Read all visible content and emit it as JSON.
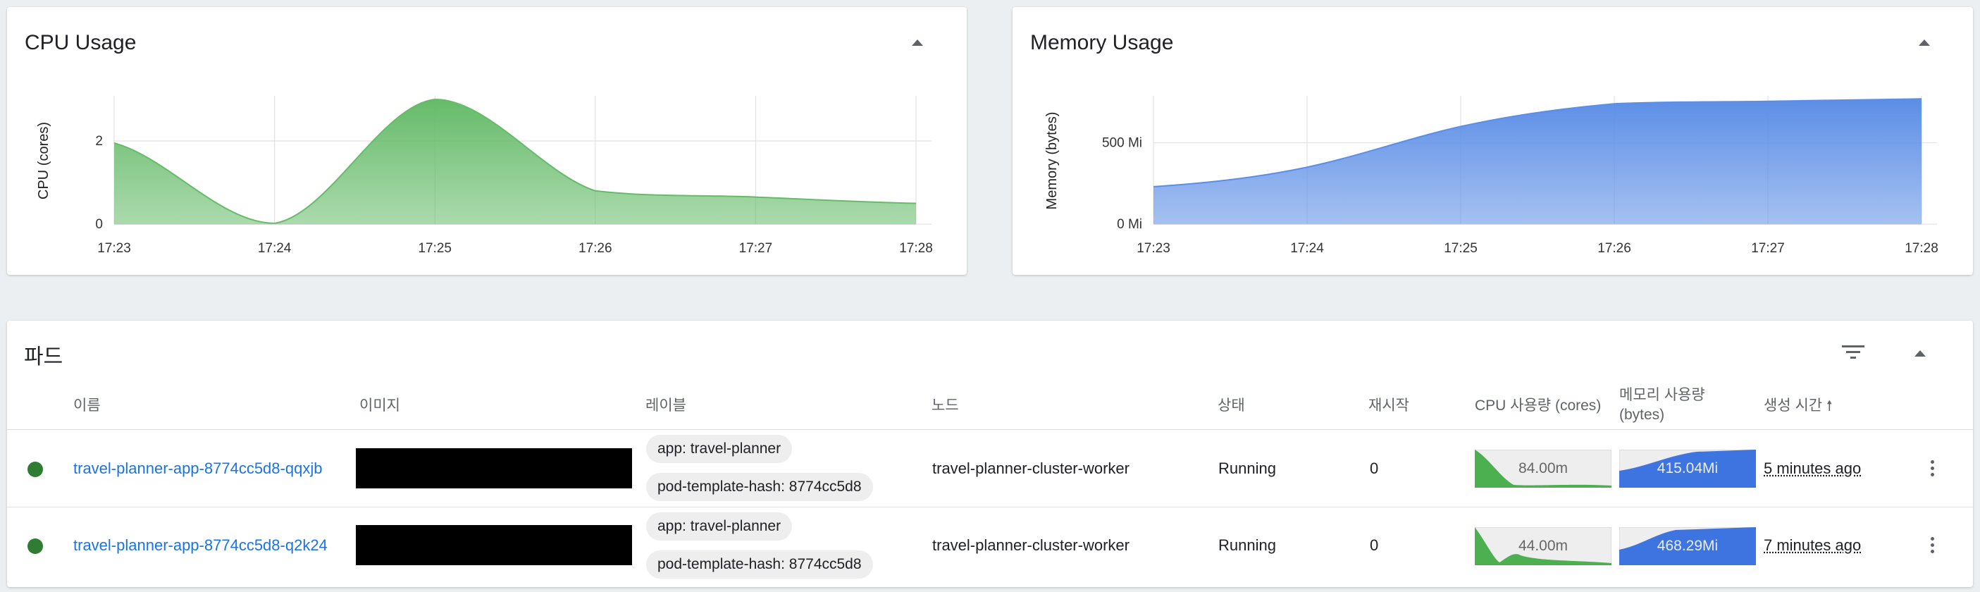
{
  "cpu_card": {
    "title": "CPU Usage",
    "chart_data": {
      "type": "area",
      "title": "",
      "ylabel": "CPU (cores)",
      "xlabel": "",
      "x": [
        "17:23",
        "17:24",
        "17:25",
        "17:26",
        "17:27",
        "17:28"
      ],
      "x_ticks": [
        "17:23",
        "17:24",
        "17:25",
        "17:26",
        "17:27",
        "17:28"
      ],
      "y_ticks": [
        "0",
        "2"
      ],
      "ylim": [
        0,
        3.05
      ],
      "series": [
        {
          "values": [
            1.95,
            0.02,
            3.0,
            0.8,
            0.65,
            0.5
          ]
        }
      ],
      "color": "#66bb6a",
      "grid": true
    }
  },
  "memory_card": {
    "title": "Memory Usage",
    "chart_data": {
      "type": "area",
      "title": "",
      "ylabel": "Memory (bytes)",
      "xlabel": "",
      "x": [
        "17:23",
        "17:24",
        "17:25",
        "17:26",
        "17:27",
        "17:28"
      ],
      "x_ticks": [
        "17:23",
        "17:24",
        "17:25",
        "17:26",
        "17:27",
        "17:28"
      ],
      "y_ticks": [
        "0 Mi",
        "500 Mi"
      ],
      "ylim": [
        0,
        780
      ],
      "series": [
        {
          "values": [
            230,
            350,
            600,
            740,
            755,
            770
          ]
        }
      ],
      "color": "#5c8ee6",
      "grid": true
    }
  },
  "pods_card": {
    "title": "파드",
    "columns": {
      "name": "이름",
      "image": "이미지",
      "labels": "레이블",
      "node": "노드",
      "status": "상태",
      "restarts": "재시작",
      "cpu": "CPU 사용량 (cores)",
      "memory_line1": "메모리 사용량",
      "memory_line2": "(bytes)",
      "created": "생성 시간"
    },
    "rows": [
      {
        "name": "travel-planner-app-8774cc5d8-qqxjb",
        "labels": [
          "app: travel-planner",
          "pod-template-hash: 8774cc5d8"
        ],
        "node": "travel-planner-cluster-worker",
        "status": "Running",
        "restarts": "0",
        "cpu": "84.00m",
        "memory": "415.04Mi",
        "created": "5 minutes ago"
      },
      {
        "name": "travel-planner-app-8774cc5d8-q2k24",
        "labels": [
          "app: travel-planner",
          "pod-template-hash: 8774cc5d8"
        ],
        "node": "travel-planner-cluster-worker",
        "status": "Running",
        "restarts": "0",
        "cpu": "44.00m",
        "memory": "468.29Mi",
        "created": "7 minutes ago"
      }
    ]
  },
  "colors": {
    "cpu_green": "#66bb6a",
    "memory_blue": "#5c8ee6",
    "link_blue": "#1a73e8",
    "status_green": "#2e7d32"
  }
}
